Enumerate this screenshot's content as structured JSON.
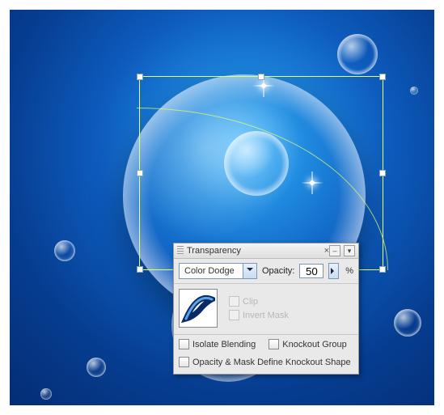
{
  "panel": {
    "title": "Transparency",
    "blend_mode": "Color Dodge",
    "opacity_label": "Opacity:",
    "opacity_value": "50",
    "opacity_unit": "%",
    "clip_label": "Clip",
    "invert_mask_label": "Invert Mask",
    "isolate_label": "Isolate Blending",
    "knockout_label": "Knockout Group",
    "define_knockout_label": "Opacity & Mask Define Knockout Shape"
  }
}
